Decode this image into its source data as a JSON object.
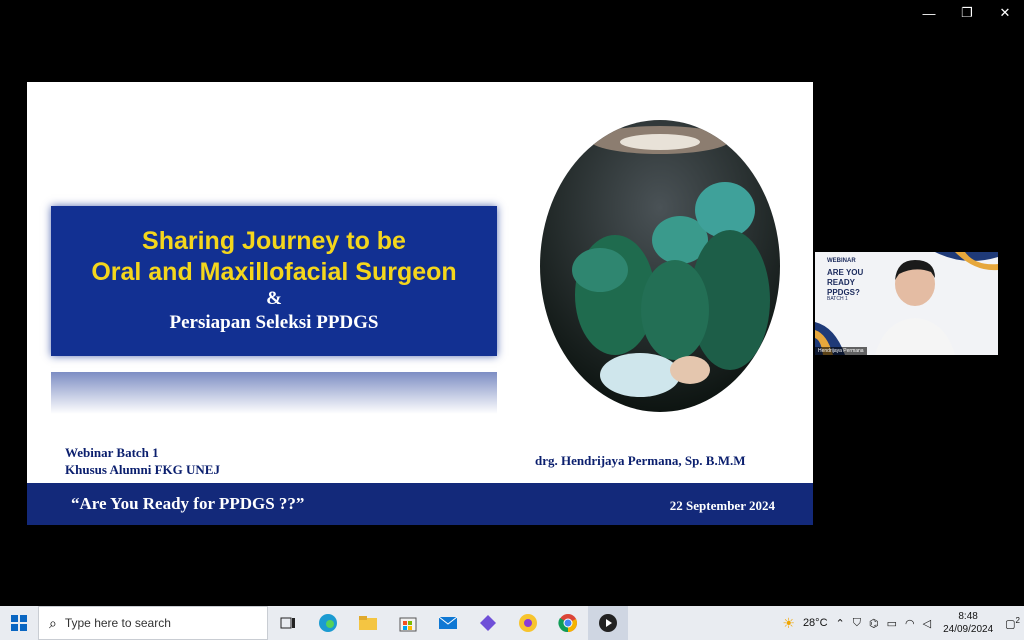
{
  "window": {
    "minimize_glyph": "—",
    "restore_glyph": "❐",
    "close_glyph": "✕"
  },
  "slide": {
    "title_line1": "Sharing Journey to be",
    "title_line2": "Oral and Maxillofacial Surgeon",
    "ampersand": "&",
    "subtitle": "Persiapan Seleksi PPDGS",
    "webinar_line1": "Webinar Batch 1",
    "webinar_line2": "Khusus Alumni FKG UNEJ",
    "presenter": "drg. Hendrijaya Permana, Sp. B.M.M",
    "quote": "“Are You Ready for PPDGS ??”",
    "date": "22 September 2024",
    "colors": {
      "title_box": "#123092",
      "title_text": "#f4d61c",
      "band": "#13297a"
    }
  },
  "video": {
    "label": "WEBINAR",
    "title": "ARE YOU READY PPDGS?",
    "batch": "BATCH 1",
    "participant": "Hendrijaya Permana"
  },
  "taskbar": {
    "search_placeholder": "Type here to search",
    "icons": [
      "windows-start-icon",
      "task-view-icon",
      "edge-icon",
      "file-explorer-icon",
      "store-icon",
      "mail-icon",
      "app-icon",
      "app-icon-2",
      "chrome-icon",
      "media-player-icon"
    ],
    "temperature": "28°C",
    "time": "8:48",
    "date": "24/09/2024",
    "notification_count": "2"
  }
}
